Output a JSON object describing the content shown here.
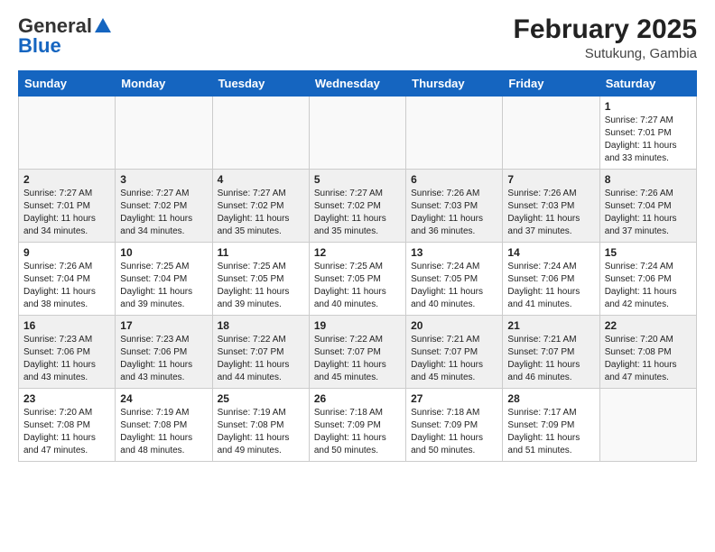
{
  "header": {
    "logo_general": "General",
    "logo_blue": "Blue",
    "month_title": "February 2025",
    "location": "Sutukung, Gambia"
  },
  "days_of_week": [
    "Sunday",
    "Monday",
    "Tuesday",
    "Wednesday",
    "Thursday",
    "Friday",
    "Saturday"
  ],
  "weeks": [
    [
      {
        "day": "",
        "info": ""
      },
      {
        "day": "",
        "info": ""
      },
      {
        "day": "",
        "info": ""
      },
      {
        "day": "",
        "info": ""
      },
      {
        "day": "",
        "info": ""
      },
      {
        "day": "",
        "info": ""
      },
      {
        "day": "1",
        "info": "Sunrise: 7:27 AM\nSunset: 7:01 PM\nDaylight: 11 hours\nand 33 minutes."
      }
    ],
    [
      {
        "day": "2",
        "info": "Sunrise: 7:27 AM\nSunset: 7:01 PM\nDaylight: 11 hours\nand 34 minutes."
      },
      {
        "day": "3",
        "info": "Sunrise: 7:27 AM\nSunset: 7:02 PM\nDaylight: 11 hours\nand 34 minutes."
      },
      {
        "day": "4",
        "info": "Sunrise: 7:27 AM\nSunset: 7:02 PM\nDaylight: 11 hours\nand 35 minutes."
      },
      {
        "day": "5",
        "info": "Sunrise: 7:27 AM\nSunset: 7:02 PM\nDaylight: 11 hours\nand 35 minutes."
      },
      {
        "day": "6",
        "info": "Sunrise: 7:26 AM\nSunset: 7:03 PM\nDaylight: 11 hours\nand 36 minutes."
      },
      {
        "day": "7",
        "info": "Sunrise: 7:26 AM\nSunset: 7:03 PM\nDaylight: 11 hours\nand 37 minutes."
      },
      {
        "day": "8",
        "info": "Sunrise: 7:26 AM\nSunset: 7:04 PM\nDaylight: 11 hours\nand 37 minutes."
      }
    ],
    [
      {
        "day": "9",
        "info": "Sunrise: 7:26 AM\nSunset: 7:04 PM\nDaylight: 11 hours\nand 38 minutes."
      },
      {
        "day": "10",
        "info": "Sunrise: 7:25 AM\nSunset: 7:04 PM\nDaylight: 11 hours\nand 39 minutes."
      },
      {
        "day": "11",
        "info": "Sunrise: 7:25 AM\nSunset: 7:05 PM\nDaylight: 11 hours\nand 39 minutes."
      },
      {
        "day": "12",
        "info": "Sunrise: 7:25 AM\nSunset: 7:05 PM\nDaylight: 11 hours\nand 40 minutes."
      },
      {
        "day": "13",
        "info": "Sunrise: 7:24 AM\nSunset: 7:05 PM\nDaylight: 11 hours\nand 40 minutes."
      },
      {
        "day": "14",
        "info": "Sunrise: 7:24 AM\nSunset: 7:06 PM\nDaylight: 11 hours\nand 41 minutes."
      },
      {
        "day": "15",
        "info": "Sunrise: 7:24 AM\nSunset: 7:06 PM\nDaylight: 11 hours\nand 42 minutes."
      }
    ],
    [
      {
        "day": "16",
        "info": "Sunrise: 7:23 AM\nSunset: 7:06 PM\nDaylight: 11 hours\nand 43 minutes."
      },
      {
        "day": "17",
        "info": "Sunrise: 7:23 AM\nSunset: 7:06 PM\nDaylight: 11 hours\nand 43 minutes."
      },
      {
        "day": "18",
        "info": "Sunrise: 7:22 AM\nSunset: 7:07 PM\nDaylight: 11 hours\nand 44 minutes."
      },
      {
        "day": "19",
        "info": "Sunrise: 7:22 AM\nSunset: 7:07 PM\nDaylight: 11 hours\nand 45 minutes."
      },
      {
        "day": "20",
        "info": "Sunrise: 7:21 AM\nSunset: 7:07 PM\nDaylight: 11 hours\nand 45 minutes."
      },
      {
        "day": "21",
        "info": "Sunrise: 7:21 AM\nSunset: 7:07 PM\nDaylight: 11 hours\nand 46 minutes."
      },
      {
        "day": "22",
        "info": "Sunrise: 7:20 AM\nSunset: 7:08 PM\nDaylight: 11 hours\nand 47 minutes."
      }
    ],
    [
      {
        "day": "23",
        "info": "Sunrise: 7:20 AM\nSunset: 7:08 PM\nDaylight: 11 hours\nand 47 minutes."
      },
      {
        "day": "24",
        "info": "Sunrise: 7:19 AM\nSunset: 7:08 PM\nDaylight: 11 hours\nand 48 minutes."
      },
      {
        "day": "25",
        "info": "Sunrise: 7:19 AM\nSunset: 7:08 PM\nDaylight: 11 hours\nand 49 minutes."
      },
      {
        "day": "26",
        "info": "Sunrise: 7:18 AM\nSunset: 7:09 PM\nDaylight: 11 hours\nand 50 minutes."
      },
      {
        "day": "27",
        "info": "Sunrise: 7:18 AM\nSunset: 7:09 PM\nDaylight: 11 hours\nand 50 minutes."
      },
      {
        "day": "28",
        "info": "Sunrise: 7:17 AM\nSunset: 7:09 PM\nDaylight: 11 hours\nand 51 minutes."
      },
      {
        "day": "",
        "info": ""
      }
    ]
  ]
}
